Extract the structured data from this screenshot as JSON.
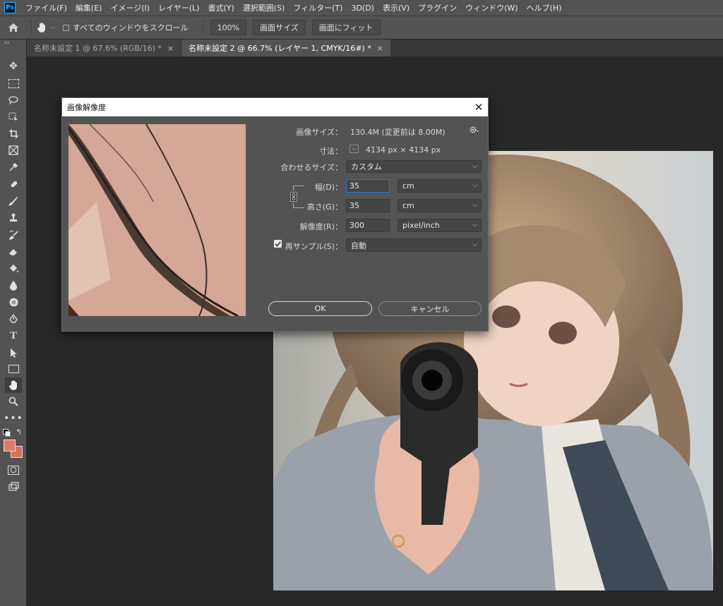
{
  "menu": {
    "logo": "Ps",
    "items": [
      "ファイル(F)",
      "編集(E)",
      "イメージ(I)",
      "レイヤー(L)",
      "書式(Y)",
      "選択範囲(S)",
      "フィルター(T)",
      "3D(D)",
      "表示(V)",
      "プラグイン",
      "ウィンドウ(W)",
      "ヘルプ(H)"
    ]
  },
  "options": {
    "scroll_all_label": "すべてのウィンドウをスクロール",
    "zoom_100": "100%",
    "fit_screen_size": "画面サイズ",
    "fit_screen": "画面にフィット"
  },
  "tabs": [
    {
      "label": "名称未設定 1 @ 67.6% (RGB/16) *",
      "close": "×",
      "active": false
    },
    {
      "label": "名称未設定 2 @ 66.7% (レイヤー 1, CMYK/16#) *",
      "close": "×",
      "active": true
    }
  ],
  "toolbar_icons": [
    "move-tool-icon",
    "marquee-tool-icon",
    "lasso-tool-icon",
    "object-select-tool-icon",
    "crop-tool-icon",
    "frame-tool-icon",
    "eyedropper-tool-icon",
    "healing-brush-icon",
    "brush-tool-icon",
    "clone-stamp-icon",
    "history-brush-icon",
    "eraser-tool-icon",
    "paint-bucket-icon",
    "blur-tool-icon",
    "dodge-tool-icon",
    "pen-tool-icon",
    "type-tool-icon",
    "path-select-tool-icon",
    "rectangle-tool-icon",
    "hand-tool-icon",
    "zoom-tool-icon",
    "more-tools-icon"
  ],
  "colors": {
    "foreground": "#e07a6a",
    "background": "#d9705f",
    "accent": "#2c6fd6"
  },
  "dialog": {
    "title": "画像解像度",
    "close": "✕",
    "image_size_label": "画像サイズ：",
    "image_size_value": "130.4M (変更前は 8.00M)",
    "dimensions_label": "寸法：",
    "dimensions_value": "4134 px × 4134 px",
    "fit_to_label": "合わせるサイズ：",
    "fit_to_value": "カスタム",
    "width_label": "幅(D)：",
    "width_value": "35",
    "width_unit": "cm",
    "height_label": "高さ(G)：",
    "height_value": "35",
    "height_unit": "cm",
    "resolution_label": "解像度(R)：",
    "resolution_value": "300",
    "resolution_unit": "pixel/inch",
    "resample_label": "再サンプル(S)：",
    "resample_checked": true,
    "resample_value": "自動",
    "ok_label": "OK",
    "cancel_label": "キャンセル"
  }
}
